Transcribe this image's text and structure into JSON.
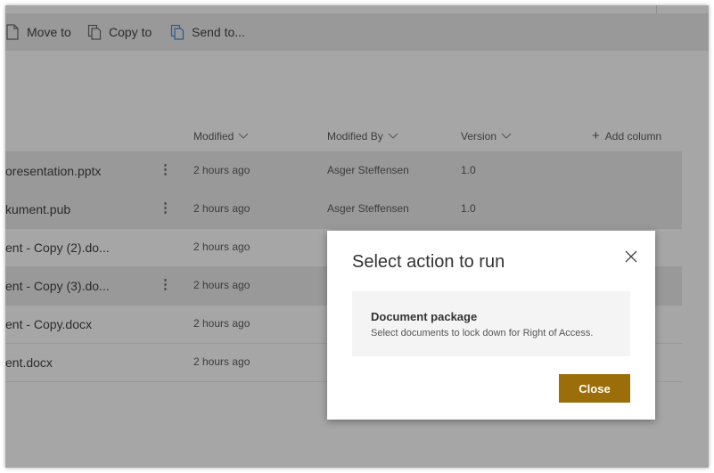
{
  "commands": [
    {
      "label": "Move to",
      "icon": "move-to-icon"
    },
    {
      "label": "Copy to",
      "icon": "copy-to-icon"
    },
    {
      "label": "Send to...",
      "icon": "send-to-icon"
    }
  ],
  "columns": {
    "modified": "Modified",
    "modified_by": "Modified By",
    "version": "Version",
    "add_column": "Add column"
  },
  "rows": [
    {
      "name": "oresentation.pptx",
      "modified": "2 hours ago",
      "modified_by": "Asger Steffensen",
      "version": "1.0",
      "selected": true
    },
    {
      "name": "kument.pub",
      "modified": "2 hours ago",
      "modified_by": "Asger Steffensen",
      "version": "1.0",
      "selected": true
    },
    {
      "name": "ent - Copy (2).do...",
      "modified": "2 hours ago",
      "modified_by": "",
      "version": "",
      "selected": false
    },
    {
      "name": "ent - Copy (3).do...",
      "modified": "2 hours ago",
      "modified_by": "",
      "version": "",
      "selected": true
    },
    {
      "name": "ent - Copy.docx",
      "modified": "2 hours ago",
      "modified_by": "",
      "version": "",
      "selected": false
    },
    {
      "name": "ent.docx",
      "modified": "2 hours ago",
      "modified_by": "",
      "version": "",
      "selected": false
    }
  ],
  "dialog": {
    "title": "Select action to run",
    "option_title": "Document package",
    "option_desc": "Select documents to lock down for Right of Access.",
    "close_label": "Close"
  },
  "colors": {
    "accent": "#9b6e0a",
    "overlay": "#a6a6a6",
    "selected_row": "#999999"
  }
}
